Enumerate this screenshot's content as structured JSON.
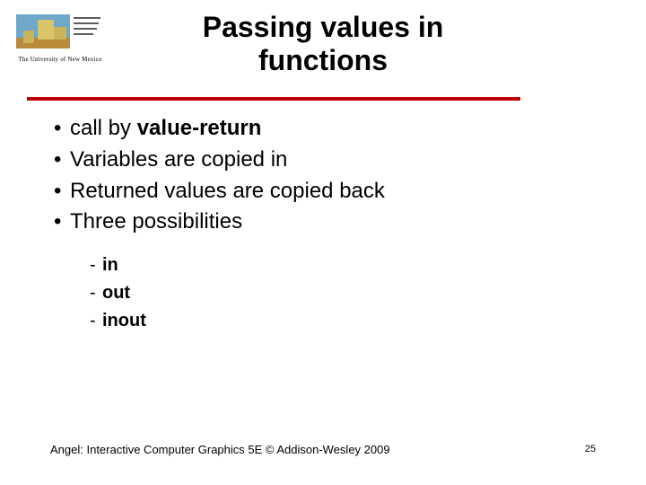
{
  "logo": {
    "caption": "The University of New Mexico"
  },
  "title": "Passing values in functions",
  "bullets": [
    {
      "prefix": "call by ",
      "strong": "value-return"
    },
    {
      "text": "Variables are copied in"
    },
    {
      "text": "Returned values are copied back"
    },
    {
      "text": "Three possibilities"
    }
  ],
  "subbullets": [
    "in",
    "out",
    "inout"
  ],
  "footer": "Angel: Interactive Computer Graphics 5E © Addison-Wesley 2009",
  "page_number": "25"
}
